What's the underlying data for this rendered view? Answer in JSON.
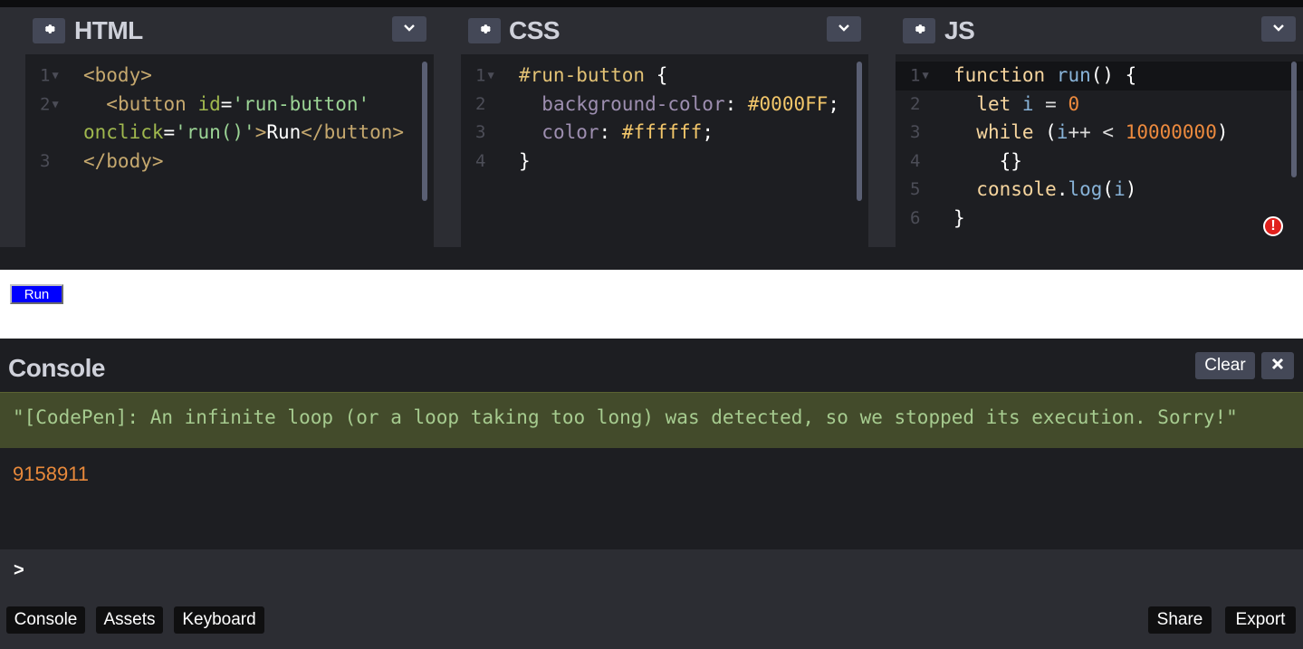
{
  "editors": {
    "html": {
      "title": "HTML",
      "lines": [
        {
          "n": "1",
          "fold": true,
          "parts": [
            {
              "c": "t-tag",
              "t": "<body>"
            }
          ]
        },
        {
          "n": "2",
          "fold": true,
          "parts": [
            {
              "c": "t-plain",
              "t": "  "
            },
            {
              "c": "t-tag",
              "t": "<button "
            },
            {
              "c": "t-attr",
              "t": "id"
            },
            {
              "c": "t-plain",
              "t": "="
            },
            {
              "c": "t-str",
              "t": "'run-button'"
            }
          ]
        },
        {
          "n": "",
          "fold": false,
          "parts": [
            {
              "c": "t-attr",
              "t": "onclick"
            },
            {
              "c": "t-plain",
              "t": "="
            },
            {
              "c": "t-str",
              "t": "'run()'"
            },
            {
              "c": "t-tag",
              "t": ">"
            },
            {
              "c": "t-plain",
              "t": "Run"
            },
            {
              "c": "t-tag",
              "t": "</button>"
            }
          ]
        },
        {
          "n": "3",
          "fold": false,
          "parts": [
            {
              "c": "t-tag",
              "t": "</body>"
            }
          ]
        }
      ]
    },
    "css": {
      "title": "CSS",
      "lines": [
        {
          "n": "1",
          "fold": true,
          "parts": [
            {
              "c": "t-sel",
              "t": "#run-button"
            },
            {
              "c": "t-plain",
              "t": " {"
            }
          ]
        },
        {
          "n": "2",
          "fold": false,
          "parts": [
            {
              "c": "t-plain",
              "t": "  "
            },
            {
              "c": "t-prop",
              "t": "background-color"
            },
            {
              "c": "t-plain",
              "t": ": "
            },
            {
              "c": "t-val",
              "t": "#0000FF"
            },
            {
              "c": "t-plain",
              "t": ";"
            }
          ]
        },
        {
          "n": "3",
          "fold": false,
          "parts": [
            {
              "c": "t-plain",
              "t": "  "
            },
            {
              "c": "t-prop",
              "t": "color"
            },
            {
              "c": "t-plain",
              "t": ": "
            },
            {
              "c": "t-val",
              "t": "#ffffff"
            },
            {
              "c": "t-plain",
              "t": ";"
            }
          ]
        },
        {
          "n": "4",
          "fold": false,
          "parts": [
            {
              "c": "t-plain",
              "t": "}"
            }
          ]
        }
      ]
    },
    "js": {
      "title": "JS",
      "lines": [
        {
          "n": "1",
          "fold": true,
          "parts": [
            {
              "c": "t-kw",
              "t": "function "
            },
            {
              "c": "t-fn",
              "t": "run"
            },
            {
              "c": "t-plain",
              "t": "() {"
            }
          ]
        },
        {
          "n": "2",
          "fold": false,
          "parts": [
            {
              "c": "t-plain",
              "t": "  "
            },
            {
              "c": "t-kw",
              "t": "let "
            },
            {
              "c": "t-fn",
              "t": "i"
            },
            {
              "c": "t-op",
              "t": " = "
            },
            {
              "c": "t-num",
              "t": "0"
            }
          ]
        },
        {
          "n": "3",
          "fold": false,
          "parts": [
            {
              "c": "t-plain",
              "t": "  "
            },
            {
              "c": "t-kw",
              "t": "while "
            },
            {
              "c": "t-plain",
              "t": "("
            },
            {
              "c": "t-fn",
              "t": "i"
            },
            {
              "c": "t-op",
              "t": "++ < "
            },
            {
              "c": "t-num",
              "t": "10000000"
            },
            {
              "c": "t-plain",
              "t": ")"
            }
          ]
        },
        {
          "n": "4",
          "fold": false,
          "parts": [
            {
              "c": "t-plain",
              "t": "    {}"
            }
          ]
        },
        {
          "n": "5",
          "fold": false,
          "parts": [
            {
              "c": "t-plain",
              "t": "  "
            },
            {
              "c": "t-kw",
              "t": "console"
            },
            {
              "c": "t-plain",
              "t": "."
            },
            {
              "c": "t-fn",
              "t": "log"
            },
            {
              "c": "t-plain",
              "t": "("
            },
            {
              "c": "t-fn",
              "t": "i"
            },
            {
              "c": "t-plain",
              "t": ")"
            }
          ]
        },
        {
          "n": "6",
          "fold": false,
          "parts": [
            {
              "c": "t-plain",
              "t": "}"
            }
          ]
        }
      ]
    }
  },
  "preview": {
    "run_label": "Run"
  },
  "console": {
    "title": "Console",
    "clear_label": "Clear",
    "warning": "\"[CodePen]: An infinite loop (or a loop taking too long) was detected, so we stopped its execution. Sorry!\"",
    "log_value": "9158911",
    "prompt": ">"
  },
  "footer": {
    "left": [
      "Console",
      "Assets",
      "Keyboard"
    ],
    "right": [
      "Share",
      "Export"
    ]
  },
  "error_marker": "!",
  "colors": {
    "accent_blue": "#0000ff",
    "warning_bg": "#434b2b",
    "error_red": "#e0201c"
  }
}
